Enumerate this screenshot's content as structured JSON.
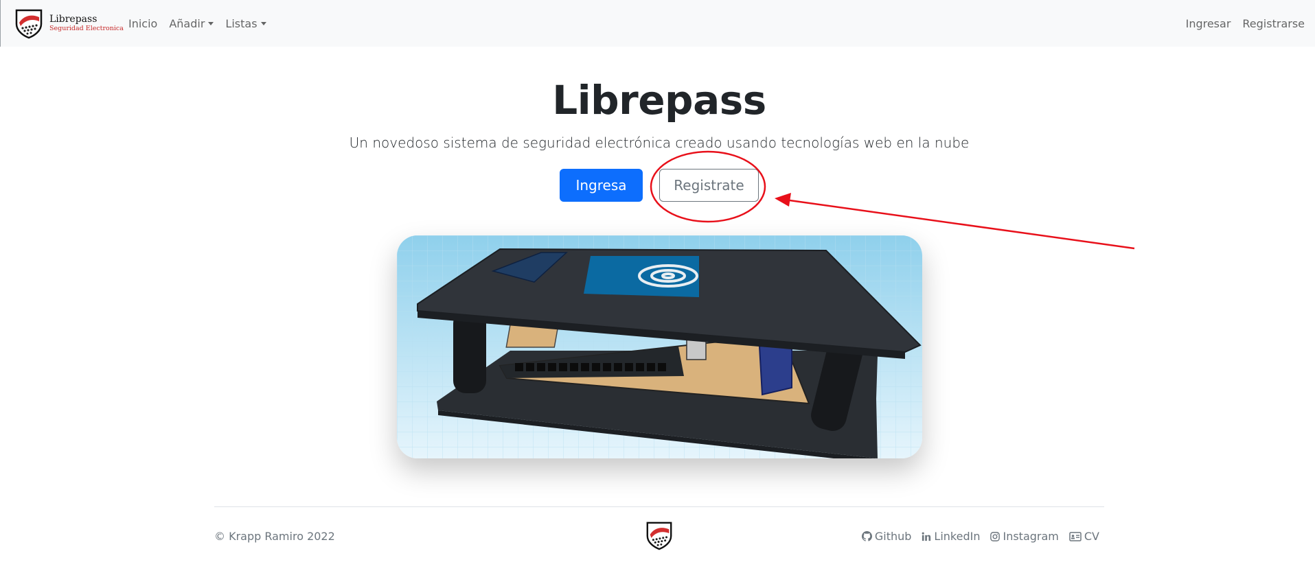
{
  "brand": {
    "name": "Librepass",
    "tagline": "Seguridad Electronica"
  },
  "nav": {
    "left": [
      {
        "label": "Inicio",
        "dropdown": false
      },
      {
        "label": "Añadir",
        "dropdown": true
      },
      {
        "label": "Listas",
        "dropdown": true
      }
    ],
    "right": [
      {
        "label": "Ingresar"
      },
      {
        "label": "Registrarse"
      }
    ]
  },
  "hero": {
    "title": "Librepass",
    "subtitle": "Un novedoso sistema de seguridad electrónica creado usando tecnologías web en la nube",
    "primary_button": "Ingresa",
    "secondary_button": "Registrate"
  },
  "footer": {
    "copyright": "© Krapp Ramiro 2022",
    "links": [
      {
        "label": "Github",
        "icon": "github-icon"
      },
      {
        "label": "LinkedIn",
        "icon": "linkedin-icon"
      },
      {
        "label": "Instagram",
        "icon": "instagram-icon"
      },
      {
        "label": "CV",
        "icon": "id-card-icon"
      }
    ]
  },
  "colors": {
    "primary": "#0d6efd",
    "secondary": "#6c757d",
    "navbar_bg": "#f8f9fa",
    "annotation": "#e8101a"
  }
}
